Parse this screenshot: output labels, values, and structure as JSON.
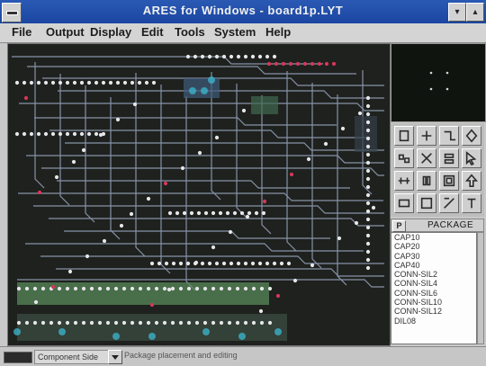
{
  "window": {
    "title": "ARES for Windows - board1p.LYT",
    "min_glyph": "▾",
    "max_glyph": "▴"
  },
  "menu": [
    "File",
    "Output",
    "Display",
    "Edit",
    "Tools",
    "System",
    "Help"
  ],
  "tools": [
    "place-component-icon",
    "component-icon",
    "track-icon",
    "via-icon",
    "pad-icon",
    "ratsnest-icon",
    "connectivity-icon",
    "select-arrow-icon",
    "dimension-icon",
    "square-pad-icon",
    "zone-icon",
    "up-arrow-icon",
    "label-icon",
    "box-icon",
    "graphics-icon",
    "text-icon"
  ],
  "packages_panel": {
    "button_label": "P",
    "title": "PACKAGE",
    "items": [
      "CAP10",
      "CAP20",
      "CAP30",
      "CAP40",
      "CONN-SIL2",
      "CONN-SIL4",
      "CONN-SIL6",
      "CONN-SIL10",
      "CONN-SIL12",
      "DIL08"
    ]
  },
  "status": {
    "layer": "Component Side",
    "message": "Package placement and editing"
  },
  "colors": {
    "titlebar": "#1f4aa8",
    "board_bg": "#1e211d",
    "track": "#9aa6c2",
    "pad": "#e6e6ea",
    "pad_red": "#d9365a",
    "copper_green": "#5b8f5e",
    "copper_cyan": "#3bb0c8"
  }
}
